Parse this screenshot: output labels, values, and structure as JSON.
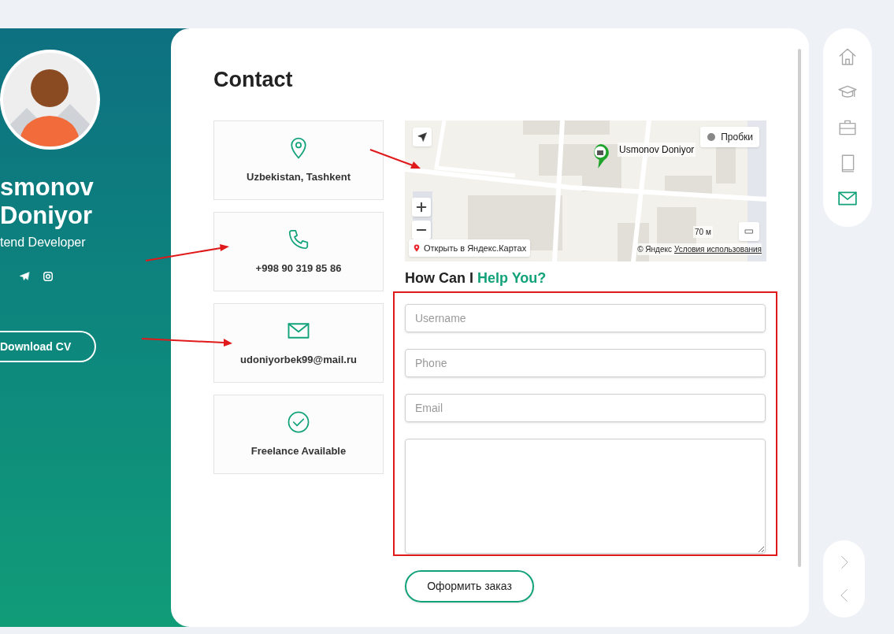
{
  "profile": {
    "name_lines": [
      "smonov",
      "Doniyor"
    ],
    "role": "tend Developer",
    "socials": [
      {
        "kind": "telegram"
      },
      {
        "kind": "instagram"
      }
    ],
    "download_button": "Download CV"
  },
  "contact": {
    "title": "Contact",
    "info_cards": [
      {
        "kind": "location",
        "text": "Uzbekistan, Tashkent"
      },
      {
        "kind": "phone",
        "text": "+998 90 319 85 86"
      },
      {
        "kind": "email",
        "text": "udoniyorbek99@mail.ru"
      },
      {
        "kind": "check",
        "text": "Freelance Available"
      }
    ],
    "map": {
      "kind": "picture",
      "marker_label": "Usmonov Doniyor",
      "traffic_button": "Пробки",
      "open_link": "Открыть в Яндекс.Картах",
      "scale": "70 м",
      "copyright": "© Яндекс",
      "terms_link": "Условия использования"
    },
    "form_title": {
      "text": "How Can I",
      "accent": "Help You?"
    },
    "fields": [
      {
        "kind": "input",
        "placeholder": "Username"
      },
      {
        "kind": "input",
        "placeholder": "Phone"
      },
      {
        "kind": "input",
        "placeholder": "Email"
      },
      {
        "kind": "textarea"
      }
    ],
    "submit_button": "Оформить заказ"
  },
  "nav": [
    {
      "kind": "home",
      "selected": false
    },
    {
      "kind": "education",
      "selected": false
    },
    {
      "kind": "portfolio",
      "selected": false
    },
    {
      "kind": "blog",
      "selected": false
    },
    {
      "kind": "contact",
      "selected": true
    }
  ],
  "pager": [
    {
      "kind": "next"
    },
    {
      "kind": "prev"
    }
  ]
}
